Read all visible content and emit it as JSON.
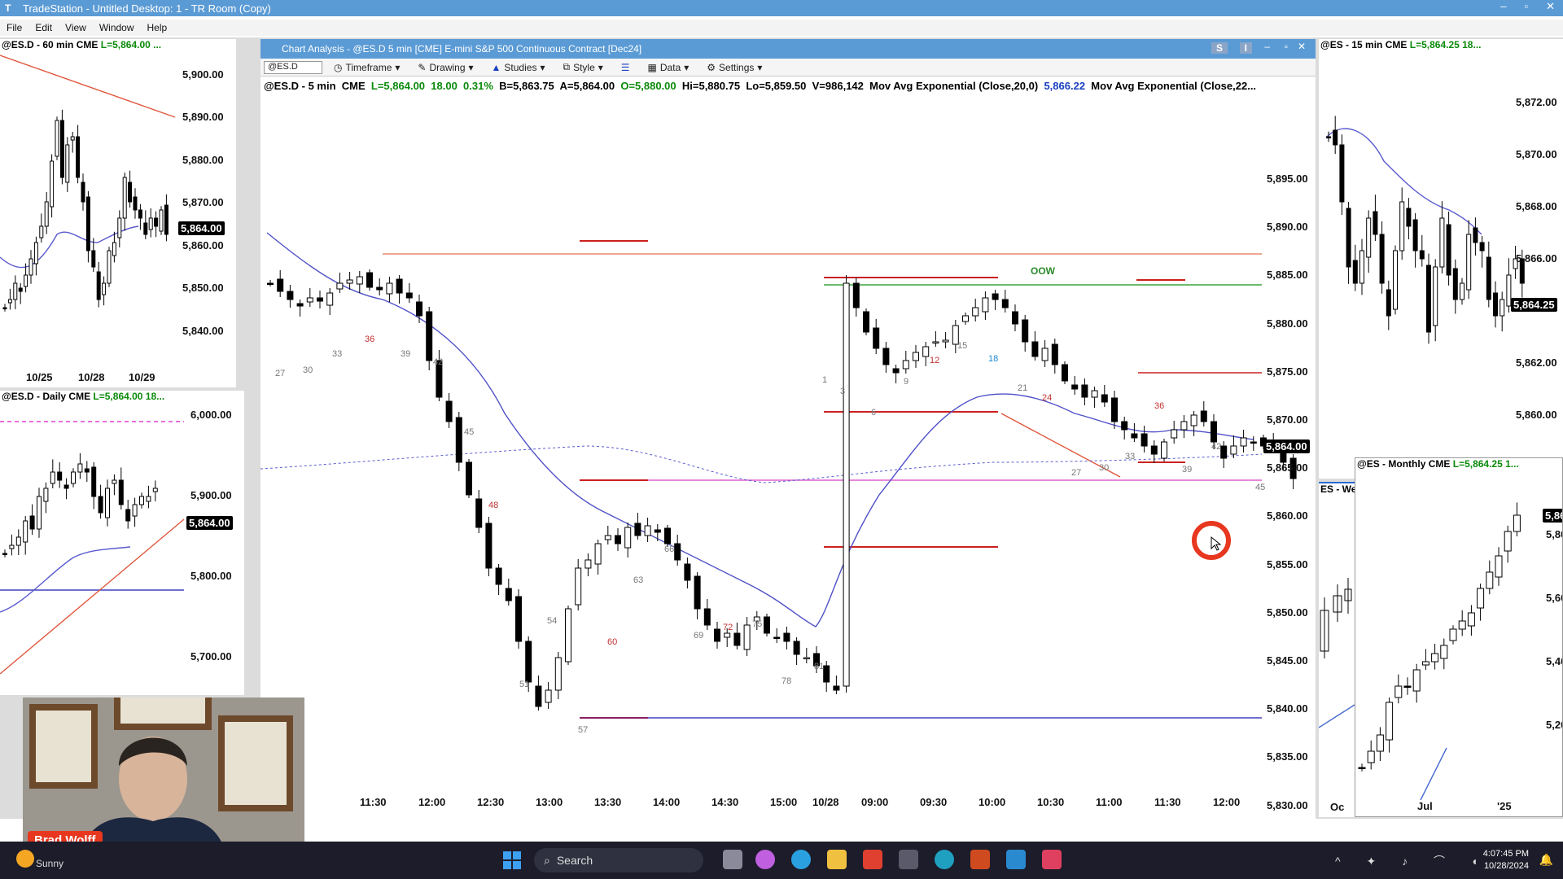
{
  "window": {
    "title": "TradeStation - Untitled Desktop: 1 - TR Room (Copy)",
    "controls": [
      "–",
      "▫",
      "✕"
    ]
  },
  "menu": [
    "File",
    "Edit",
    "View",
    "Window",
    "Help"
  ],
  "chart60": {
    "header_symbol": "@ES.D - 60 min",
    "header_exch": "CME",
    "header_last": "L=5,864.00 ...",
    "price_tag": "5,864.00",
    "y_labels": [
      "5,900.00",
      "5,890.00",
      "5,880.00",
      "5,870.00",
      "5,860.00",
      "5,850.00",
      "5,840.00"
    ],
    "x_labels": [
      "10/25",
      "10/28",
      "10/29"
    ]
  },
  "chartDaily": {
    "header_symbol": "@ES.D - Daily",
    "header_exch": "CME",
    "header_last": "L=5,864.00 18...",
    "price_tag": "5,864.00",
    "y_labels": [
      "6,000.00",
      "5,900.00",
      "5,800.00",
      "5,700.00"
    ]
  },
  "main": {
    "title": "Chart Analysis - @ES.D 5 min [CME] E-mini S&P 500 Continuous Contract [Dec24]",
    "title_buttons": [
      "S",
      "I"
    ],
    "toolbar": {
      "symbol": "@ES.D",
      "items": [
        "Timeframe",
        "Drawing",
        "Studies",
        "Style",
        "Data",
        "Settings"
      ]
    },
    "info": {
      "symbol": "@ES.D - 5 min",
      "exch": "CME",
      "last": "L=5,864.00",
      "chg": "18.00",
      "pct": "0.31%",
      "bid": "B=5,863.75",
      "ask": "A=5,864.00",
      "open": "O=5,880.00",
      "hi": "Hi=5,880.75",
      "lo": "Lo=5,859.50",
      "vol": "V=986,142",
      "ma1": "Mov Avg Exponential (Close,20,0)",
      "ma1_val": "5,866.22",
      "ma2": "Mov Avg Exponential (Close,22..."
    },
    "price_tag": "5,864.00",
    "oow_label": "OOW",
    "y_labels": [
      "5,895.00",
      "5,890.00",
      "5,885.00",
      "5,880.00",
      "5,875.00",
      "5,870.00",
      "5,865.00",
      "5,860.00",
      "5,855.00",
      "5,850.00",
      "5,845.00",
      "5,840.00",
      "5,835.00",
      "5,830.00"
    ],
    "x_labels": [
      "11:00",
      "11:30",
      "12:00",
      "12:30",
      "13:00",
      "13:30",
      "14:00",
      "14:30",
      "15:00",
      "10/28",
      "09:00",
      "09:30",
      "10:00",
      "10:30",
      "11:00",
      "11:30",
      "12:00"
    ],
    "bar_numbers_gray": [
      "27",
      "30",
      "33",
      "39",
      "42",
      "45",
      "51",
      "54",
      "57",
      "63",
      "66",
      "69",
      "75",
      "78",
      "81",
      "1",
      "3",
      "6",
      "9",
      "15",
      "21",
      "27",
      "30",
      "33",
      "39",
      "42",
      "45"
    ],
    "bar_numbers_red": [
      "36",
      "48",
      "60",
      "72",
      "12",
      "24",
      "36"
    ],
    "bar_numbers_blue": [
      "18"
    ]
  },
  "chart15": {
    "header_symbol": "@ES - 15 min",
    "header_exch": "CME",
    "header_last": "L=5,864.25 18...",
    "price_tag": "5,864.25",
    "y_labels": [
      "5,872.00",
      "5,870.00",
      "5,868.00",
      "5,866.00",
      "5,864.00",
      "5,862.00",
      "5,860.00"
    ]
  },
  "chartMonthly": {
    "header_symbol": "@ES - Monthly",
    "header_exch": "CME",
    "header_last": "L=5,864.25 1...",
    "price_tag": "5,86",
    "y_labels": [
      "5,80",
      "5,60",
      "5,40",
      "5,20"
    ],
    "x_labels": [
      "Jul",
      "'25"
    ]
  },
  "chartWeekly": {
    "header_fragment": "ES - We",
    "x_label": "Oc"
  },
  "webcam": {
    "name": "Brad Wolff"
  },
  "taskbar": {
    "weather": "Sunny",
    "search_placeholder": "Search",
    "time": "4:07:45 PM",
    "date": "10/28/2024"
  }
}
